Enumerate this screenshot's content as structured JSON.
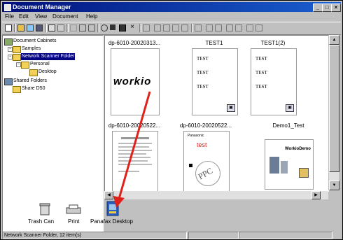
{
  "window": {
    "title": "Document Manager"
  },
  "menu": [
    "File",
    "Edit",
    "View",
    "Document",
    "Help"
  ],
  "tree": {
    "items": [
      {
        "label": "Document Cabinets",
        "icon": "cabinet-icon"
      },
      {
        "label": "Samples",
        "icon": "folder-icon"
      },
      {
        "label": "Network Scanner Folder",
        "icon": "folder-icon",
        "selected": true
      },
      {
        "label": "Personal",
        "icon": "folder-icon"
      },
      {
        "label": "Desktop",
        "icon": "folder-icon"
      },
      {
        "label": "Shared Folders",
        "icon": "network-icon"
      },
      {
        "label": "Share D50",
        "icon": "folder-icon"
      }
    ]
  },
  "documents": [
    {
      "caption": "dp-6010-20020313...",
      "type": "logo",
      "logo_text": "WORKiO"
    },
    {
      "caption": "TEST1",
      "type": "text",
      "lines": [
        "TEST",
        "TEST",
        "TEST"
      ]
    },
    {
      "caption": "TEST1(2)",
      "type": "text",
      "lines": [
        "TEST",
        "TEST",
        "TEST"
      ]
    },
    {
      "caption": "dp-6010-20020522...",
      "type": "page"
    },
    {
      "caption": "dp-6010-20020522...",
      "type": "poster",
      "brand": "Panasonic",
      "title": "test",
      "stamp": "PPC"
    },
    {
      "caption": "Demo1_Test",
      "type": "brochure",
      "heading": "WorkioDemo"
    }
  ],
  "dock": [
    {
      "label": "Trash Can",
      "icon": "trash-can-icon"
    },
    {
      "label": "Print",
      "icon": "printer-icon"
    },
    {
      "label": "Panafax Desktop",
      "icon": "panafax-desktop-icon"
    }
  ],
  "status": {
    "text": "Network Scanner Folder, 12 item(s)"
  },
  "colors": {
    "title_bar": "#00107a",
    "selection": "#000080",
    "arrow": "#e0211b",
    "window_bg": "#c0c0c0"
  }
}
